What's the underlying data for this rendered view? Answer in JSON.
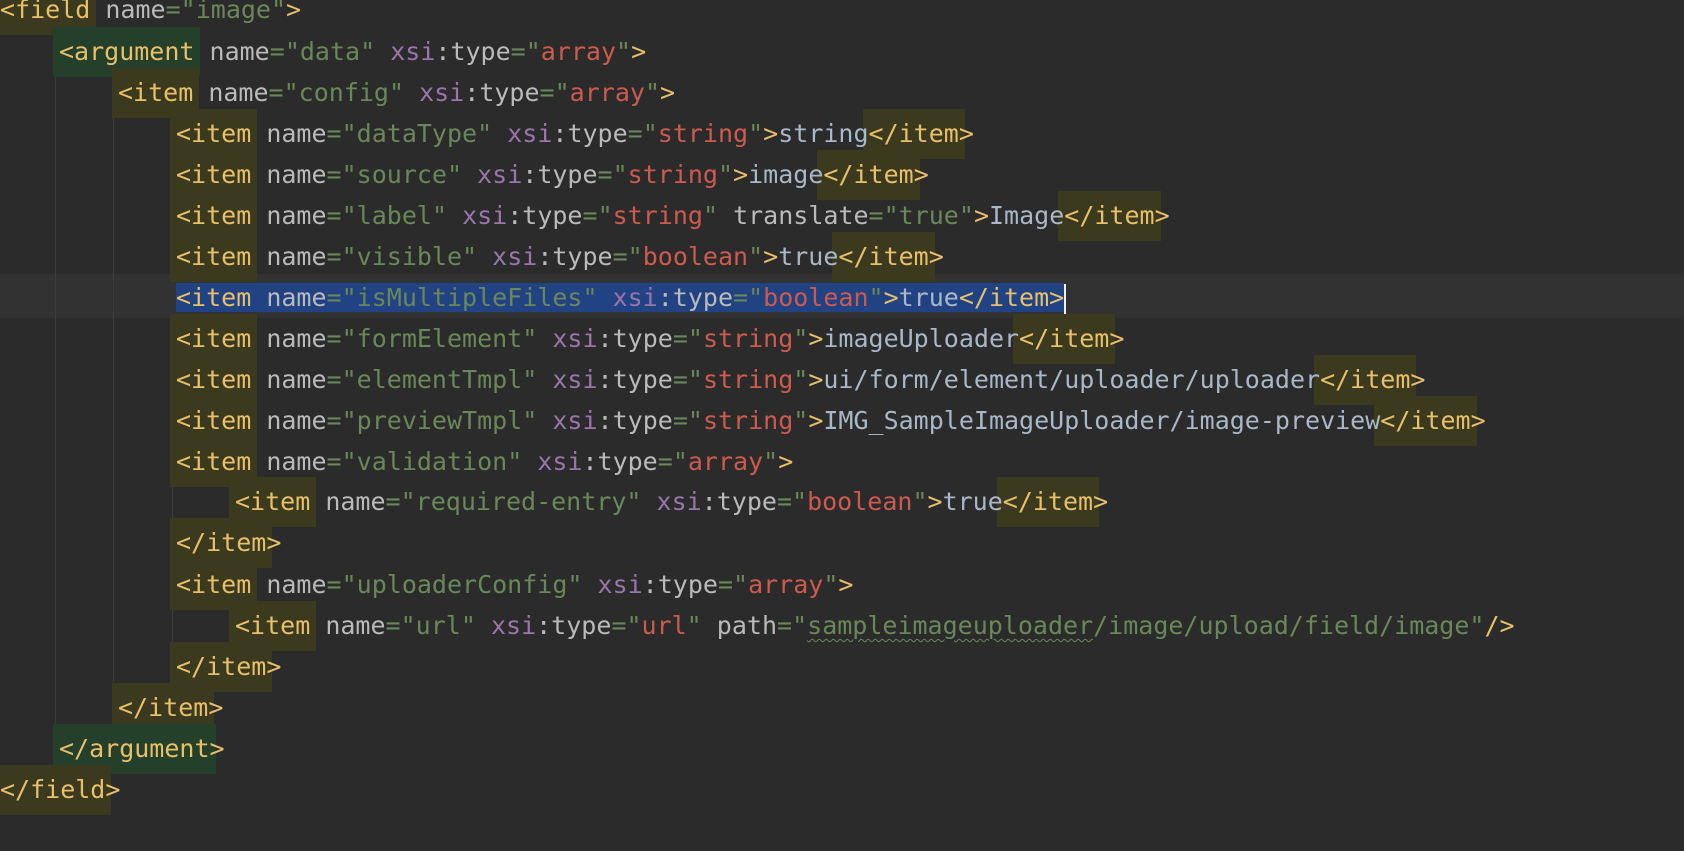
{
  "editor": {
    "language": "XML",
    "selected_line": "<item name=\"isMultipleFiles\" xsi:type=\"boolean\">true</item>",
    "lines": [
      "<field name=\"image\">",
      "<argument name=\"data\" xsi:type=\"array\">",
      "<item name=\"config\" xsi:type=\"array\">",
      "<item name=\"dataType\" xsi:type=\"string\">string</item>",
      "<item name=\"source\" xsi:type=\"string\">image</item>",
      "<item name=\"label\" xsi:type=\"string\" translate=\"true\">Image</item>",
      "<item name=\"visible\" xsi:type=\"boolean\">true</item>",
      "<item name=\"isMultipleFiles\" xsi:type=\"boolean\">true</item>",
      "<item name=\"formElement\" xsi:type=\"string\">imageUploader</item>",
      "<item name=\"elementTmpl\" xsi:type=\"string\">ui/form/element/uploader/uploader</item>",
      "<item name=\"previewTmpl\" xsi:type=\"string\">IMG_SampleImageUploader/image-preview</item>",
      "<item name=\"validation\" xsi:type=\"array\">",
      "<item name=\"required-entry\" xsi:type=\"boolean\">true</item>",
      "</item>",
      "<item name=\"uploaderConfig\" xsi:type=\"array\">",
      "<item name=\"url\" xsi:type=\"url\" path=\"sampleimageuploader/image/upload/field/image\"/>",
      "</item>",
      "</item>",
      "</argument>",
      "</field>"
    ]
  },
  "colors": {
    "background": "#2b2b2b",
    "tag": "#e8bf6a",
    "attribute": "#bababa",
    "namespace": "#9876aa",
    "string_value": "#6a8759",
    "type_value": "#cc5b4e",
    "text": "#a9b7c6",
    "selection": "#214283"
  }
}
